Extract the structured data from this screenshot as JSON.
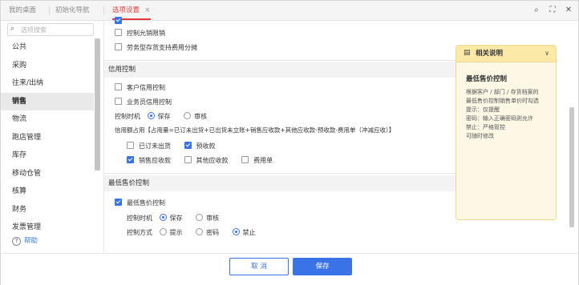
{
  "tabs": [
    {
      "label": "我的桌面"
    },
    {
      "label": "初始化导航"
    },
    {
      "label": "选项设置",
      "close": "×"
    }
  ],
  "window_icons": [
    "search-icon",
    "expand-icon",
    "close-icon"
  ],
  "window_icon_glyphs": {
    "search": "⌕",
    "expand": "⛶",
    "close": "✕"
  },
  "sidebar": {
    "search_placeholder": "选项搜索",
    "items": [
      {
        "label": "公共"
      },
      {
        "label": "采购"
      },
      {
        "label": "往来/出纳"
      },
      {
        "label": "销售",
        "active": true
      },
      {
        "label": "物流"
      },
      {
        "label": "跑店管理"
      },
      {
        "label": "库存"
      },
      {
        "label": "移动仓管"
      },
      {
        "label": "核算"
      },
      {
        "label": "财务"
      },
      {
        "label": "发票管理"
      }
    ],
    "help_icon": "?",
    "help_label": "帮助"
  },
  "main": {
    "top_rows": [
      {
        "label": "控制允销限销",
        "checked": false
      },
      {
        "label": "劳务型存货支持费用分摊",
        "checked": false
      }
    ],
    "credit": {
      "title": "信用控制",
      "customer_label": "客户信用控制",
      "salesman_label": "业务员信用控制",
      "timing_label": "控制时机",
      "timing_options": [
        "保存",
        "审核"
      ],
      "timing_selected": "保存",
      "formula": "信用额占用【占用量=已订未出货+已出货未立账+销售应收款+其他应收款-预收款-费用单（冲减应收）】",
      "occupy_items": [
        {
          "label": "已订未出货",
          "checked": false
        },
        {
          "label": "预收款",
          "checked": true
        },
        {
          "label": "销售应收款",
          "checked": true
        },
        {
          "label": "其他应收款",
          "checked": false
        },
        {
          "label": "费用单",
          "checked": false
        }
      ]
    },
    "min_price": {
      "title": "最低售价控制",
      "enable_label": "最低售价控制",
      "enabled": true,
      "timing_label": "控制时机",
      "timing_options": [
        "保存",
        "审核"
      ],
      "timing_selected": "保存",
      "method_label": "控制方式",
      "method_options": [
        "提示",
        "密码",
        "禁止"
      ],
      "method_selected": "禁止"
    }
  },
  "info_panel": {
    "header": "相关说明",
    "chevron": "∨",
    "doc_icon": "▤",
    "title": "最低售价控制",
    "lines": [
      "根据客户 / 部门 / 存货档案的",
      "最低售价控制销售单价时勾选",
      "提示：仅提醒",
      "密码：输入正确密码则允许",
      "禁止：严格管控",
      "可随时修改"
    ]
  },
  "footer": {
    "cancel_label": "取 消",
    "save_label": "保存"
  },
  "colors": {
    "accent": "#3a73e8",
    "tab_active": "#e23b3b",
    "panel_bg": "#fdf8e6",
    "panel_head": "#fbe9a8"
  }
}
